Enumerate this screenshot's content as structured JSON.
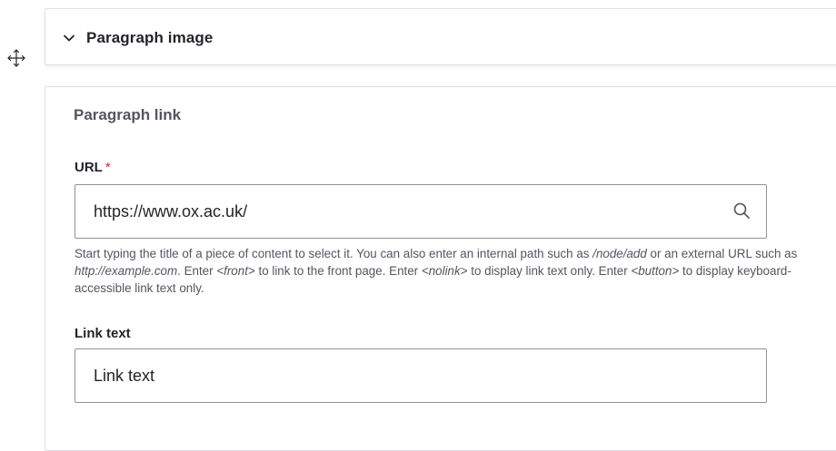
{
  "paragraph_image": {
    "title": "Paragraph image",
    "toggle_icon": "chevron-down-icon"
  },
  "drag_handle_icon": "move-icon",
  "paragraph_link": {
    "legend": "Paragraph link",
    "url_field": {
      "label": "URL",
      "required_marker": "*",
      "value": "https://www.ox.ac.uk/",
      "icon": "search-icon",
      "description": {
        "p1": "Start typing the title of a piece of content to select it. You can also enter an internal path such as ",
        "em1": "/node/add",
        "p2": " or an external URL such as ",
        "em2": "http://example.com",
        "p3": ". Enter ",
        "em3": "<front>",
        "p4": " to link to the front page. Enter ",
        "em4": "<nolink>",
        "p5": " to display link text only. Enter ",
        "em5": "<button>",
        "p6": " to display keyboard-accessible link text only."
      }
    },
    "link_text_field": {
      "label": "Link text",
      "placeholder": "Link text"
    }
  },
  "colors": {
    "border": "#dedfe4",
    "input_border": "#919297",
    "required": "#dc2323",
    "text": "#232429",
    "muted_text": "#545560"
  }
}
